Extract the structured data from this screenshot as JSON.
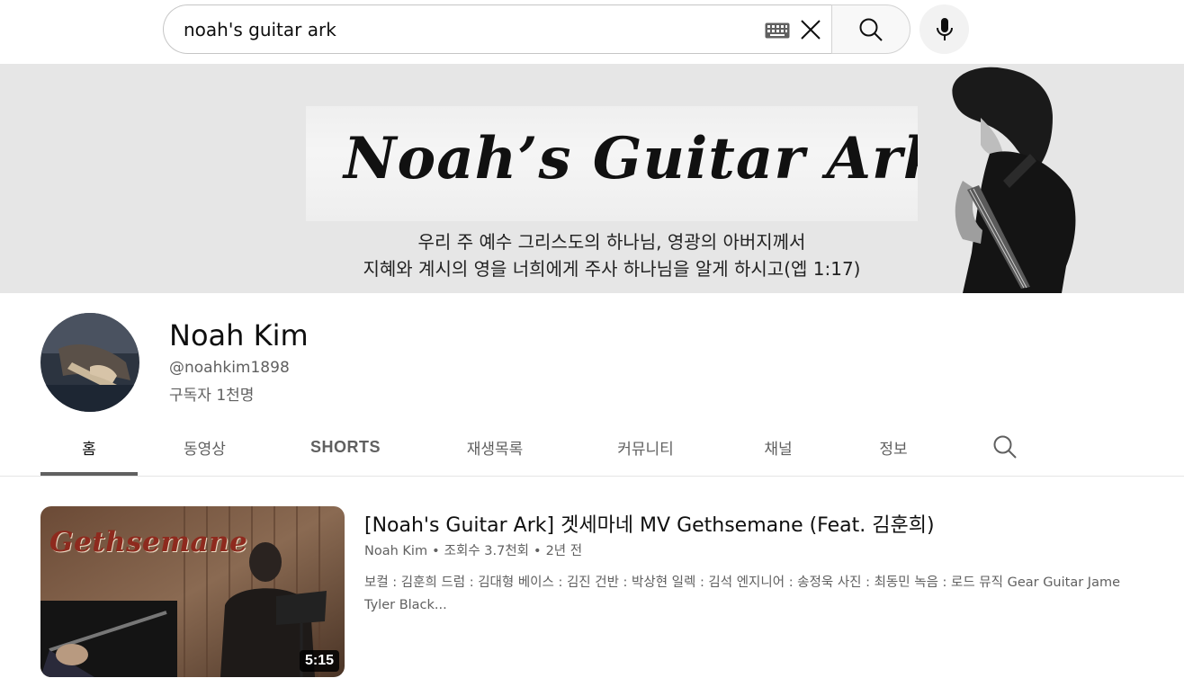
{
  "search": {
    "value": "noah's guitar ark",
    "keyboard_icon": "keyboard-icon",
    "clear_icon": "close-icon",
    "search_icon": "search-icon",
    "mic_icon": "microphone-icon"
  },
  "banner": {
    "title": "Noah’s Guitar Ark",
    "verse_line1": "우리 주 예수 그리스도의 하나님, 영광의 아버지께서",
    "verse_line2": "지혜와 계시의 영을 너희에게 주사 하나님을 알게 하시고(엡 1:17)"
  },
  "channel": {
    "name": "Noah Kim",
    "handle": "@noahkim1898",
    "subscribers": "구독자 1천명"
  },
  "tabs": [
    {
      "label": "홈",
      "active": true
    },
    {
      "label": "동영상"
    },
    {
      "label": "SHORTS"
    },
    {
      "label": "재생목록"
    },
    {
      "label": "커뮤니티"
    },
    {
      "label": "채널"
    },
    {
      "label": "정보"
    }
  ],
  "tab_search_icon": "search-icon",
  "video": {
    "title": "[Noah's Guitar Ark] 겟세마네 MV Gethsemane (Feat. 김훈희)",
    "channel": "Noah Kim",
    "views": "조회수 3.7천회",
    "age": "2년 전",
    "separator": "•",
    "description": "보컬 : 김훈희 드럼 : 김대형 베이스 : 김진 건반 : 박상현 일렉 : 김석 엔지니어 : 송정욱 사진 : 최동민 녹음 : 로드 뮤직 Gear Guitar Jame Tyler Black...",
    "duration": "5:15",
    "thumbnail_text": "Gethsemane"
  },
  "colors": {
    "banner_bg": "#e6e6e6",
    "text_primary": "#0f0f0f",
    "text_secondary": "#606060",
    "tab_underline": "#606060"
  }
}
